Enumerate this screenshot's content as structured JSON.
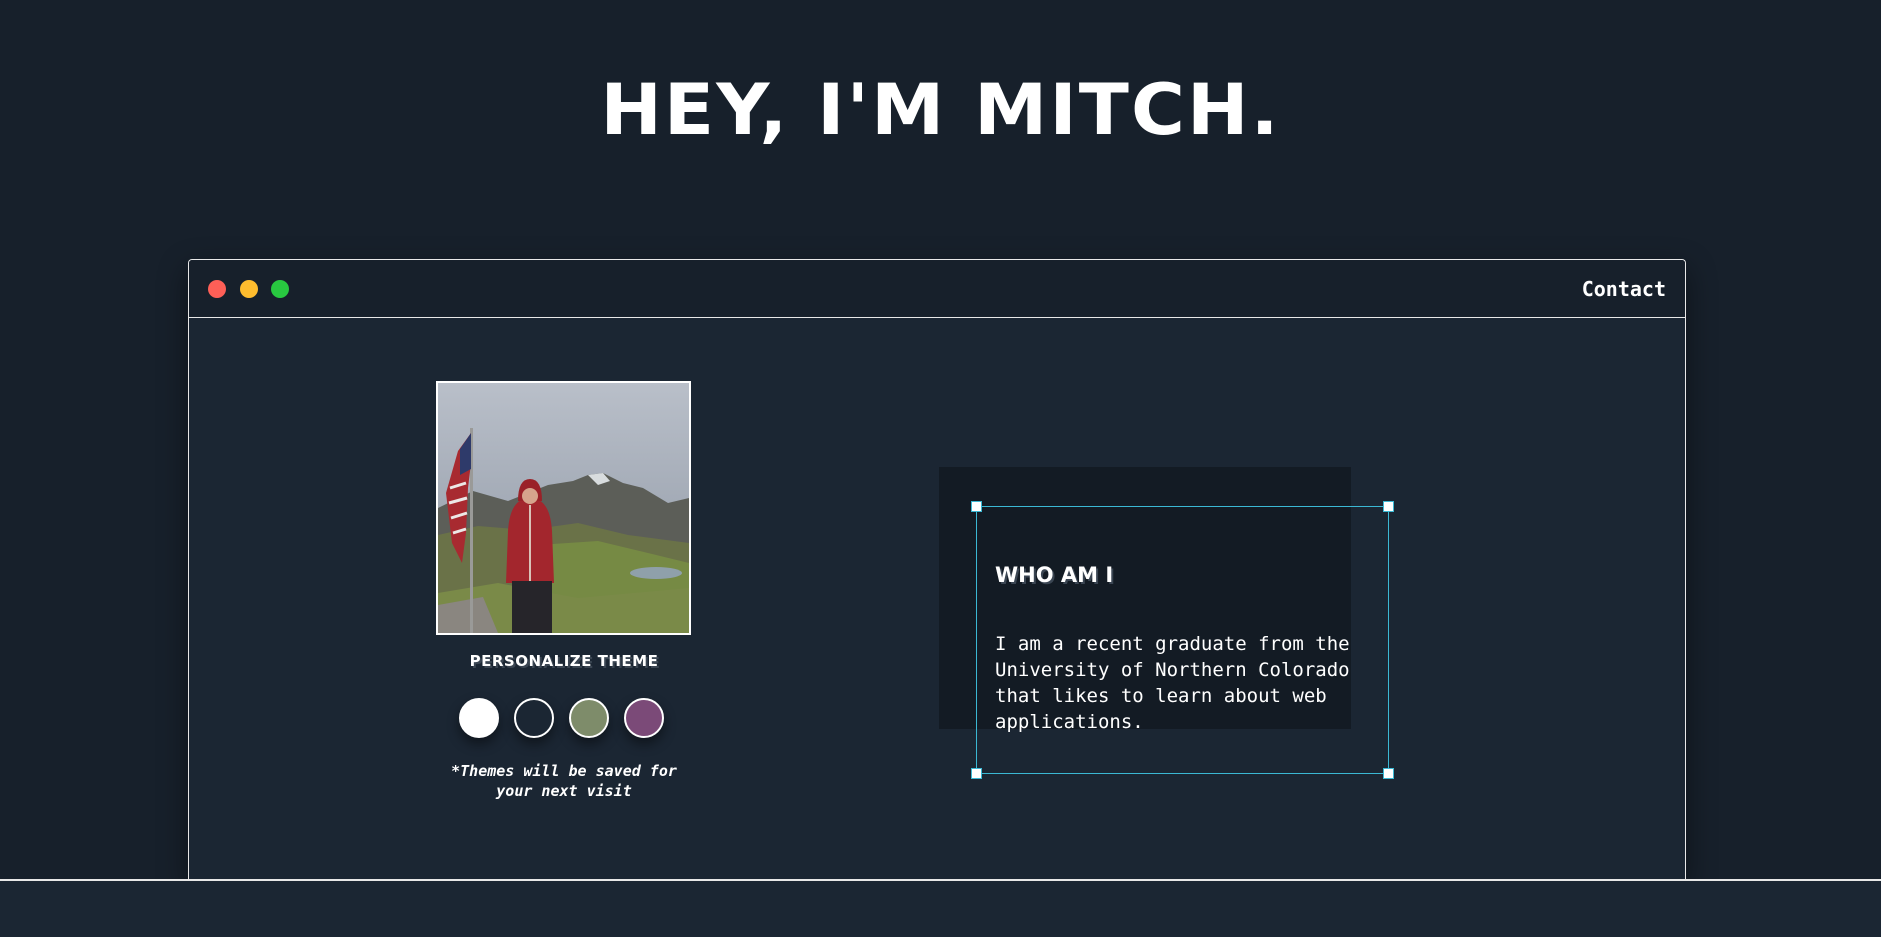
{
  "hero": {
    "title": "HEY, I'M MITCH."
  },
  "window": {
    "nav": {
      "contact_label": "Contact"
    },
    "traffic_lights": [
      "close",
      "minimize",
      "maximize"
    ]
  },
  "profile": {
    "theme_heading": "PERSONALIZE THEME",
    "theme_options": [
      {
        "name": "light",
        "color": "#ffffff"
      },
      {
        "name": "dark",
        "color": "#1b2633"
      },
      {
        "name": "sage",
        "color": "#7e8c6a"
      },
      {
        "name": "plum",
        "color": "#7b4a78"
      }
    ],
    "theme_note": "*Themes will be saved for your next visit"
  },
  "about": {
    "heading": "WHO AM I",
    "body": "I am a recent graduate from the University of Northern Colorado that likes to learn about web applications."
  },
  "colors": {
    "background": "#17202b",
    "panel": "#1b2633",
    "accent": "#3bb8d4"
  }
}
